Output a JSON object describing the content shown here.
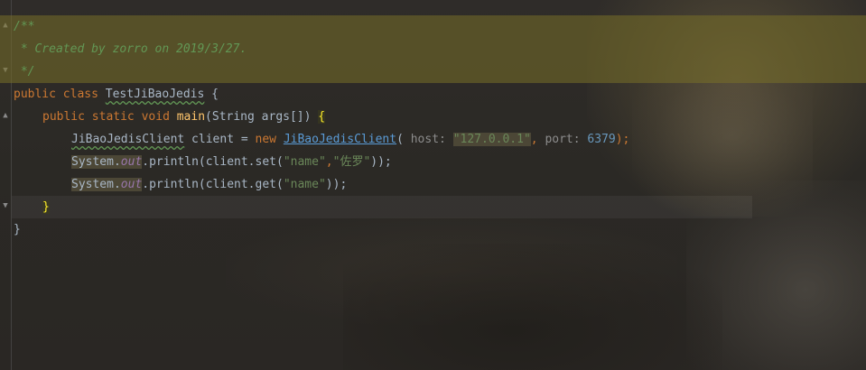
{
  "code": {
    "line1": "/**",
    "line2": " * Created by zorro on 2019/3/27.",
    "line3": " */",
    "line4": {
      "kw_public": "public",
      "kw_class": "class",
      "class_name": "TestJiBaoJedis",
      "open": " {"
    },
    "line5": {
      "kw_public": "public",
      "kw_static": "static",
      "kw_void": "void",
      "method": "main",
      "params": "(String args[]) ",
      "brace": "{"
    },
    "line6": {
      "type": "JiBaoJedisClient",
      "var": " client = ",
      "kw_new": "new",
      "ctor": "JiBaoJedisClient",
      "paren_open": "( ",
      "hint_host": "host:",
      "host_value": "\"127.0.0.1\"",
      "comma1": ",",
      "hint_port": "port:",
      "port_value": "6379",
      "end": ");"
    },
    "line7": {
      "system": "System.",
      "out": "out",
      "call": ".println(client.set(",
      "arg1": "\"name\"",
      "comma": ",",
      "arg2": "\"佐罗\"",
      "end": "));"
    },
    "line8": {
      "system": "System.",
      "out": "out",
      "call": ".println(client.get(",
      "arg1": "\"name\"",
      "end": "));"
    },
    "line9": "}",
    "line10": "}"
  },
  "colors": {
    "keyword": "#cc7832",
    "doc_comment": "#629755",
    "string": "#6a8759",
    "number": "#6897bb",
    "method": "#ffc66d",
    "field": "#9876aa",
    "link": "#5a9bd6",
    "brace_match": "#ffef28"
  },
  "icons": {
    "fold_marker": "fold-marker-icon"
  }
}
